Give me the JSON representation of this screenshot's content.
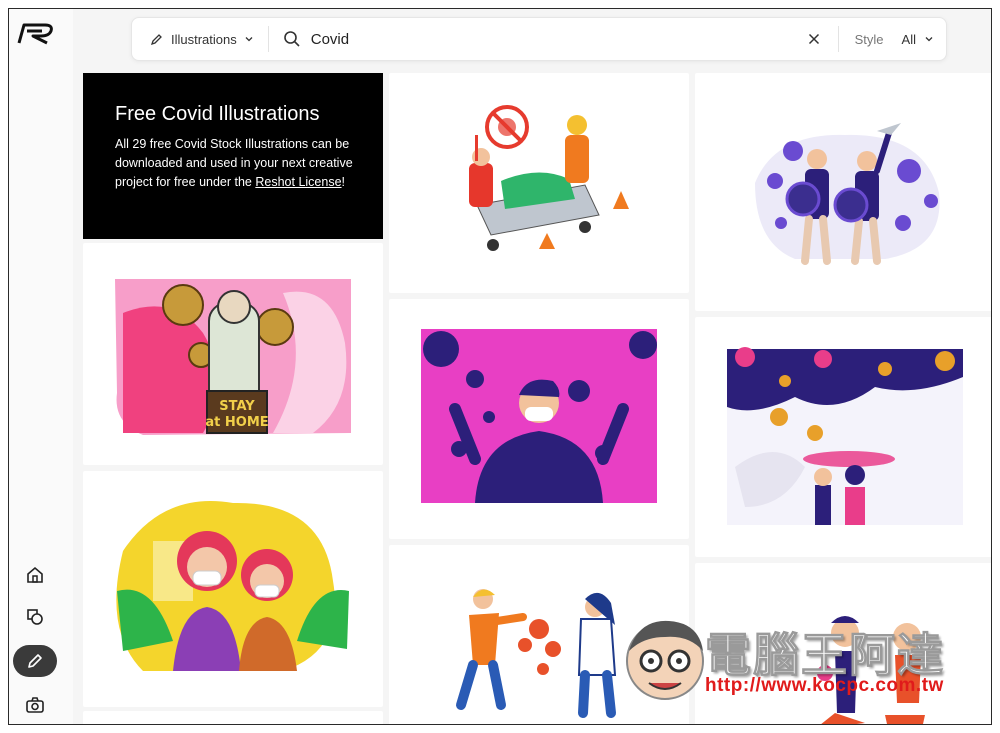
{
  "search": {
    "type_label": "Illustrations",
    "query": "Covid",
    "style_label": "Style",
    "style_value": "All"
  },
  "promo": {
    "title": "Free Covid Illustrations",
    "body": "All 29 free Covid Stock Illustrations can be downloaded and used in your next creative project for free under the ",
    "link": "Reshot License",
    "link_suffix": "!"
  },
  "illustrations": [
    {
      "name": "ambulance-paramedics"
    },
    {
      "name": "people-with-shields"
    },
    {
      "name": "stay-at-home"
    },
    {
      "name": "man-surrounded-by-virus"
    },
    {
      "name": "people-under-umbrella"
    },
    {
      "name": "women-wearing-masks"
    },
    {
      "name": "doctor-and-man-virus"
    },
    {
      "name": "people-group-masks"
    }
  ],
  "poster_text": {
    "line1": "STAY",
    "line2": "at",
    "line3": "HOME"
  },
  "watermark": {
    "text": "電腦王阿達",
    "url": "http://www.kocpc.com.tw"
  },
  "icons": [
    "logo-icon",
    "pencil-icon",
    "chevron-down-icon",
    "search-icon",
    "close-icon",
    "home-icon",
    "shapes-icon",
    "camera-icon"
  ],
  "colors": {
    "accent_dark": "#3a3a3a",
    "promo_bg": "#000000",
    "magenta": "#e83fc4",
    "navy": "#2c1f7a"
  }
}
